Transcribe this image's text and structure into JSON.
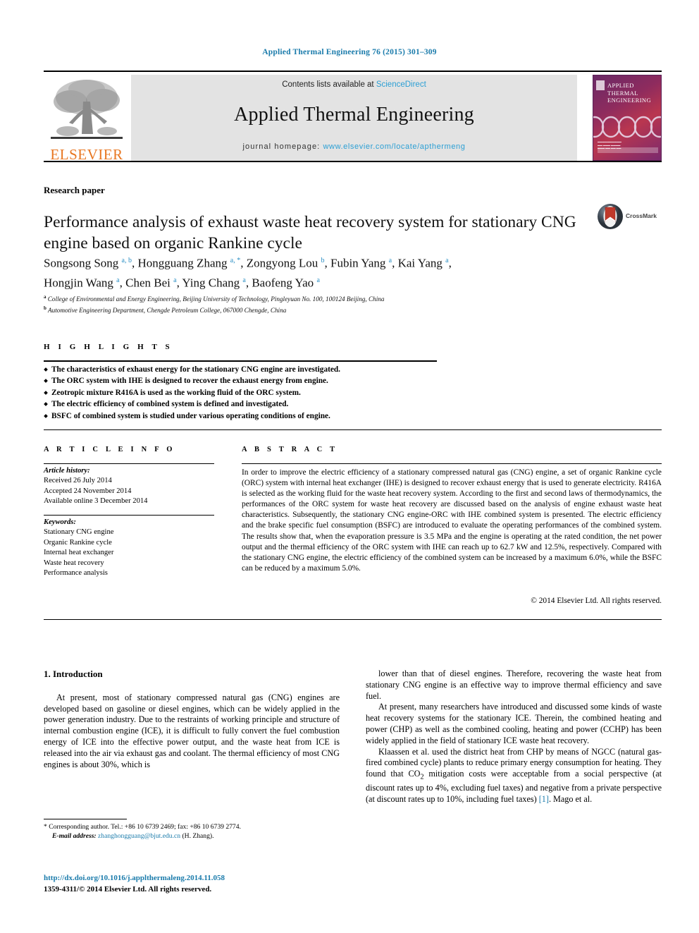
{
  "running_head": "Applied Thermal Engineering 76 (2015) 301–309",
  "masthead": {
    "contents_prefix": "Contents lists available at ",
    "sciencedirect": "ScienceDirect",
    "journal_name": "Applied Thermal Engineering",
    "homepage_label": "journal homepage: ",
    "homepage_url": "www.elsevier.com/locate/apthermeng",
    "publisher": "ELSEVIER",
    "cover_title_line1": "APPLIED",
    "cover_title_line2": "THERMAL",
    "cover_title_line3": "ENGINEERING",
    "accent_blue": "#2b9fd4",
    "elsevier_orange": "#E87722"
  },
  "article": {
    "kicker": "Research paper",
    "title": "Performance analysis of exhaust waste heat recovery system for stationary CNG engine based on organic Rankine cycle",
    "crossmark_label": "CrossMark",
    "authors_line1": "Songsong Song <sup>a, b</sup>, Hongguang Zhang <sup>a, *</sup>, Zongyong Lou <sup>b</sup>, Fubin Yang <sup>a</sup>, Kai Yang <sup>a</sup>,",
    "authors_line2": "Hongjin Wang <sup>a</sup>, Chen Bei <sup>a</sup>, Ying Chang <sup>a</sup>, Baofeng Yao <sup>a</sup>",
    "affiliation_a": "<sup>a</sup> College of Environmental and Energy Engineering, Beijing University of Technology, Pingleyuan No. 100, 100124 Beijing, China",
    "affiliation_b": "<sup>b</sup> Automotive Engineering Department, Chengde Petroleum College, 067000 Chengde, China"
  },
  "highlights": {
    "heading": "H I G H L I G H T S",
    "items": [
      "The characteristics of exhaust energy for the stationary CNG engine are investigated.",
      "The ORC system with IHE is designed to recover the exhaust energy from engine.",
      "Zeotropic mixture R416A is used as the working fluid of the ORC system.",
      "The electric efficiency of combined system is defined and investigated.",
      "BSFC of combined system is studied under various operating conditions of engine."
    ]
  },
  "article_info": {
    "heading": "A R T I C L E  I N F O",
    "history_label": "Article history:",
    "history": [
      "Received 26 July 2014",
      "Accepted 24 November 2014",
      "Available online 3 December 2014"
    ],
    "keywords_label": "Keywords:",
    "keywords": [
      "Stationary CNG engine",
      "Organic Rankine cycle",
      "Internal heat exchanger",
      "Waste heat recovery",
      "Performance analysis"
    ]
  },
  "abstract": {
    "heading": "A B S T R A C T",
    "text": "In order to improve the electric efficiency of a stationary compressed natural gas (CNG) engine, a set of organic Rankine cycle (ORC) system with internal heat exchanger (IHE) is designed to recover exhaust energy that is used to generate electricity. R416A is selected as the working fluid for the waste heat recovery system. According to the first and second laws of thermodynamics, the performances of the ORC system for waste heat recovery are discussed based on the analysis of engine exhaust waste heat characteristics. Subsequently, the stationary CNG engine-ORC with IHE combined system is presented. The electric efficiency and the brake specific fuel consumption (BSFC) are introduced to evaluate the operating performances of the combined system. The results show that, when the evaporation pressure is 3.5 MPa and the engine is operating at the rated condition, the net power output and the thermal efficiency of the ORC system with IHE can reach up to 62.7 kW and 12.5%, respectively. Compared with the stationary CNG engine, the electric efficiency of the combined system can be increased by a maximum 6.0%, while the BSFC can be reduced by a maximum 5.0%.",
    "copyright": "© 2014 Elsevier Ltd. All rights reserved."
  },
  "body": {
    "section_number_title": "1. Introduction",
    "left_paragraphs": [
      "At present, most of stationary compressed natural gas (CNG) engines are developed based on gasoline or diesel engines, which can be widely applied in the power generation industry. Due to the restraints of working principle and structure of internal combustion engine (ICE), it is difficult to fully convert the fuel combustion energy of ICE into the effective power output, and the waste heat from ICE is released into the air via exhaust gas and coolant. The thermal efficiency of most CNG engines is about 30%, which is"
    ],
    "right_paragraphs": [
      "lower than that of diesel engines. Therefore, recovering the waste heat from stationary CNG engine is an effective way to improve thermal efficiency and save fuel.",
      "At present, many researchers have introduced and discussed some kinds of waste heat recovery systems for the stationary ICE. Therein, the combined heating and power (CHP) as well as the combined cooling, heating and power (CCHP) has been widely applied in the field of stationary ICE waste heat recovery.",
      "Klaassen et al. used the district heat from CHP by means of NGCC (natural gas-fired combined cycle) plants to reduce primary energy consumption for heating. They found that CO<sub>2</sub> mitigation costs were acceptable from a social perspective (at discount rates up to 4%, excluding fuel taxes) and negative from a private perspective (at discount rates up to 10%, including fuel taxes) <span class=\"ref\">[1]</span>. Mago et al."
    ]
  },
  "footer": {
    "corresponding": "* Corresponding author. Tel.: +86 10 6739 2469; fax: +86 10 6739 2774.",
    "email_label": "E-mail address:",
    "email": "zhanghongguang@bjut.edu.cn",
    "email_suffix": " (H. Zhang).",
    "doi": "http://dx.doi.org/10.1016/j.applthermaleng.2014.11.058",
    "issn": "1359-4311/© 2014 Elsevier Ltd. All rights reserved."
  }
}
